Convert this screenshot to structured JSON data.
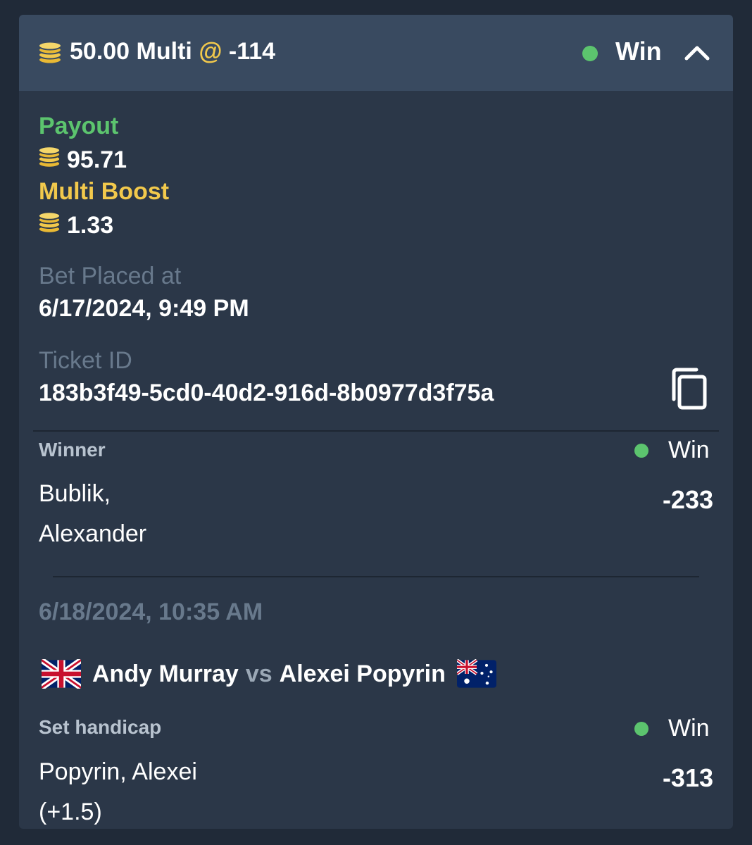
{
  "header": {
    "stake": "50.00",
    "bet_type": "Multi",
    "at_symbol": "@",
    "odds": "-114",
    "status": "Win"
  },
  "summary": {
    "payout_label": "Payout",
    "payout_value": "95.71",
    "boost_label": "Multi Boost",
    "boost_value": "1.33",
    "placed_label": "Bet Placed at",
    "placed_value": "6/17/2024, 9:49 PM",
    "ticket_label": "Ticket ID",
    "ticket_value": "183b3f49-5cd0-40d2-916d-8b0977d3f75a"
  },
  "selections": [
    {
      "market": "Winner",
      "status": "Win",
      "pick_line1": "Bublik,",
      "pick_line2": "Alexander",
      "odds": "-233"
    },
    {
      "date": "6/18/2024, 10:35 AM",
      "player1": "Andy Murray",
      "vs": "vs",
      "player2": "Alexei Popyrin",
      "market": "Set handicap",
      "status": "Win",
      "pick_line1": "Popyrin, Alexei",
      "pick_line2": "(+1.5)",
      "odds": "-313"
    }
  ],
  "colors": {
    "win_dot": "#5cc46e",
    "payout_label": "#5cc46e",
    "boost_label": "#f2c94c",
    "coin": "#f2c94c"
  },
  "icons": {
    "coin": "coin-stack-icon",
    "chevron": "chevron-up-icon",
    "copy": "copy-icon",
    "flag1": "uk-flag-icon",
    "flag2": "australia-flag-icon"
  }
}
